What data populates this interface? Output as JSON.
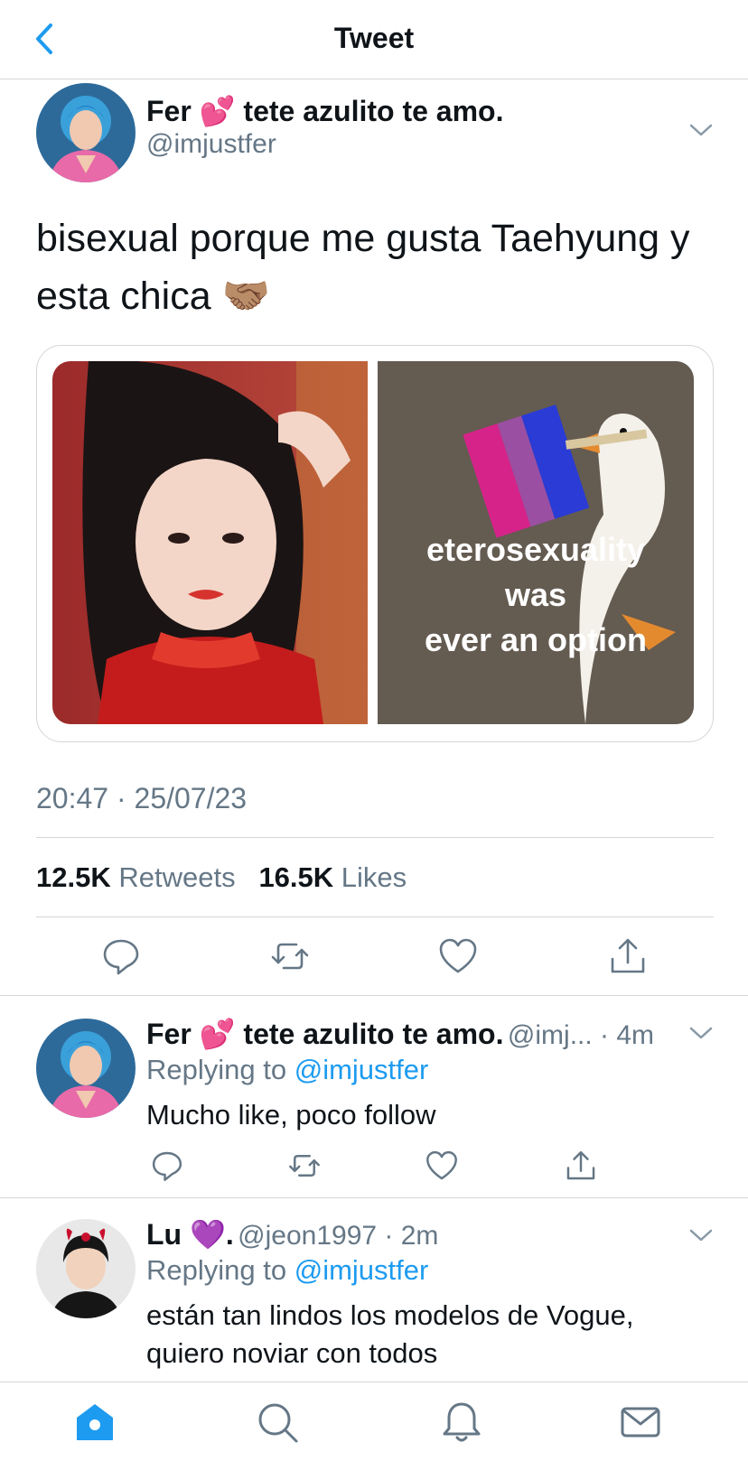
{
  "header": {
    "title": "Tweet"
  },
  "main_tweet": {
    "author_name": "Fer 💕 tete azulito te amo.",
    "handle": "@imjustfer",
    "text_line1": "bisexual porque me gusta Taehyung y",
    "text_line2": "esta chica 🤝🏽",
    "meme_lines": [
      "eterosexuality",
      "was",
      "ever an option"
    ],
    "timestamp": "20:47 · 25/07/23",
    "retweets_count": "12.5K",
    "retweets_label": "Retweets",
    "likes_count": "16.5K",
    "likes_label": "Likes"
  },
  "replies": [
    {
      "author_name": "Fer 💕 tete azulito te amo.",
      "meta": "@imj... · 4m",
      "replying_label": "Replying to",
      "replying_handle": "@imjustfer",
      "text": "Mucho like, poco follow"
    },
    {
      "author_name": "Lu 💜.",
      "meta": "@jeon1997 · 2m",
      "replying_label": "Replying to",
      "replying_handle": "@imjustfer",
      "text_line1": "están tan lindos los modelos de Vogue,",
      "text_line2": "quiero noviar con todos"
    }
  ],
  "icons": {
    "back": "chevron-left-icon",
    "caret": "chevron-down-icon",
    "reply": "comment-icon",
    "retweet": "retweet-icon",
    "like": "heart-icon",
    "share": "share-icon",
    "home": "home-icon",
    "search": "search-icon",
    "notifications": "bell-icon",
    "messages": "mail-icon"
  },
  "colors": {
    "accent": "#1d9bf0",
    "muted": "#657786",
    "divider": "#d3d6da"
  }
}
